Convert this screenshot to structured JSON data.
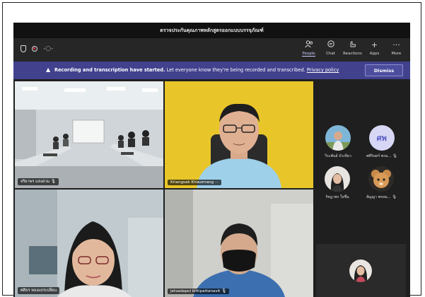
{
  "window": {
    "title": "ตรวจประกันคุณภาพหลักสูตรออกแบบบรรจุภัณฑ์"
  },
  "toolbar": {
    "left_icons": [
      "shield-icon",
      "record-icon",
      "more-dots-icon"
    ],
    "buttons": [
      {
        "label": "People",
        "icon": "people-icon",
        "active": true
      },
      {
        "label": "Chat",
        "icon": "chat-icon",
        "active": false
      },
      {
        "label": "Reactions",
        "icon": "reactions-icon",
        "active": false
      },
      {
        "label": "Apps",
        "icon": "plus-icon",
        "active": false
      },
      {
        "label": "More",
        "icon": "more-icon",
        "active": false
      }
    ]
  },
  "banner": {
    "title": "Recording and transcription have started.",
    "message": "Let everyone know they're being recorded and transcribed.",
    "link": "Privacy policy",
    "dismiss": "Dismiss"
  },
  "tiles": [
    {
      "name": "จริยาพร แสงอ่วม",
      "muted": true
    },
    {
      "name": "Kriangsak Khiaomang",
      "muted": false
    },
    {
      "name": "ศศิธร ทองแปรเปลี่ยน",
      "muted": false
    },
    {
      "name": "jetsadapol kittipattanavit",
      "muted": true
    }
  ],
  "sidebar_people": [
    {
      "name": "วีระพันธ์ บัวเขียว"
    },
    {
      "name": "ศศิรินทร์ พรม...",
      "initials": "ศพ"
    },
    {
      "name": "รัชฎาพร ใจชื่น"
    },
    {
      "name": "สัญญา พรหม..."
    }
  ],
  "colors": {
    "banner": "#41418e",
    "accent": "#c9cbff",
    "initials_avatar": "#d7d7f5",
    "recording": "#d9373e"
  }
}
